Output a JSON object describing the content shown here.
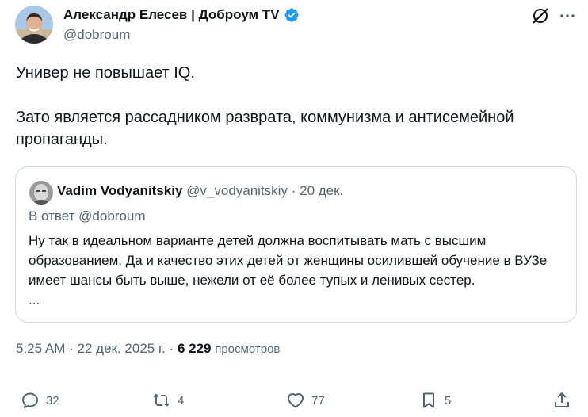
{
  "author": {
    "name": "Александр Елесев | Доброум TV",
    "handle": "@dobroum",
    "verified": true,
    "verified_color": "#1d9bf0"
  },
  "tweet": {
    "paragraph1": "Универ не повышает IQ.",
    "paragraph2": "Зато является рассадником разврата, коммунизма и антисемейной пропаганды."
  },
  "quote": {
    "name": "Vadim Vodyanitskiy",
    "handle": "@v_vodyanitskiy",
    "separator": "·",
    "date": "20 дек.",
    "reply_to": "В ответ @dobroum",
    "text": "Ну так в идеальном варианте детей должна воспитывать мать с высшим образованием. Да и качество этих детей от женщины осилившей обучение в ВУЗе имеет шансы быть выше, нежели от её более тупых и ленивых сестер.",
    "ellipsis": "..."
  },
  "meta": {
    "time": "5:25 AM",
    "separator": "·",
    "date": "22 дек. 2025 г.",
    "views_count": "6 229",
    "views_label": "просмотров"
  },
  "actions": {
    "replies": "32",
    "reposts": "4",
    "likes": "77",
    "bookmarks": "5"
  },
  "colors": {
    "text": "#0f1419",
    "secondary": "#536471",
    "border": "#cfd9de",
    "accent": "#1d9bf0"
  },
  "icons": {
    "grok": "grok-icon",
    "more": "more-icon",
    "reply": "reply-icon",
    "repost": "repost-icon",
    "like": "like-icon",
    "bookmark": "bookmark-icon",
    "share": "share-icon"
  }
}
